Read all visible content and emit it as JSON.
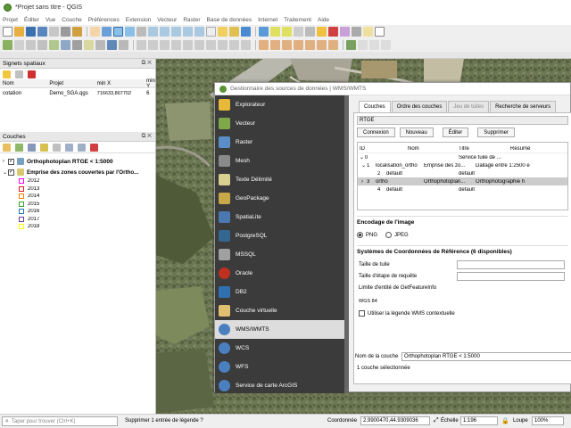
{
  "window": {
    "title": "*Projet sans titre - QGIS"
  },
  "menu": [
    "Projet",
    "Éditer",
    "Vue",
    "Couche",
    "Préférences",
    "Extension",
    "Vecteur",
    "Raster",
    "Base de données",
    "Internet",
    "Traitement",
    "Aide"
  ],
  "bookmarks": {
    "title": "Signets spatiaux",
    "columns": [
      "Nom",
      "Projet",
      "min X",
      "min Y"
    ],
    "row": [
      "cotation",
      "Demo_SGA.qgs",
      "716633,867702",
      "6"
    ]
  },
  "layers": {
    "title": "Couches",
    "items": [
      {
        "label": "Orthophotoplan RTGE < 1:5000",
        "checked": true,
        "bold": true
      },
      {
        "label": "Emprise des zones couvertes par l'Ortho...",
        "checked": true,
        "bold": true
      }
    ],
    "years": [
      {
        "label": "2012",
        "color": "#ff00ff"
      },
      {
        "label": "2013",
        "color": "#e31a1c"
      },
      {
        "label": "2014",
        "color": "#ff7f00"
      },
      {
        "label": "2015",
        "color": "#33a02c"
      },
      {
        "label": "2016",
        "color": "#1f78b4"
      },
      {
        "label": "2017",
        "color": "#6a3d9a"
      },
      {
        "label": "2018",
        "color": "#ffff00"
      }
    ]
  },
  "dialog": {
    "title": "Gestionnaire des sources de données | WMS/WMTS",
    "side": [
      "Explorateur",
      "Vecteur",
      "Raster",
      "Mesh",
      "Texte Délimité",
      "GeoPackage",
      "SpatiaLite",
      "PostgreSQL",
      "MSSQL",
      "Oracle",
      "DB2",
      "Couche virtuelle",
      "WMS/WMTS",
      "WCS",
      "WFS",
      "Service de carte ArcGIS"
    ],
    "tabs": [
      "Couches",
      "Ordre des couches",
      "Jeu de tuiles",
      "Recherche de serveurs"
    ],
    "connection": "RTGE",
    "buttons": [
      "Connexion",
      "Nouveau",
      "Éditer",
      "Supprimer"
    ],
    "tree_headers": [
      "ID",
      "Nom",
      "Titre",
      "Résumé"
    ],
    "tree_rows": [
      {
        "id": "0",
        "name": "",
        "title": "Service tuilé de ...",
        "resume": ""
      },
      {
        "id": "1",
        "name": "localisation_ortho",
        "title": "Emprise des zo...",
        "resume": "Dallage entre 1:2500 e"
      },
      {
        "id": "2",
        "name": "default",
        "title": "default",
        "resume": ""
      },
      {
        "id": "3",
        "name": "ortho",
        "title": "Orthophotoplan...",
        "resume": "Orthophotographie h"
      },
      {
        "id": "4",
        "name": "default",
        "title": "default",
        "resume": ""
      }
    ],
    "encoding_title": "Encodage de l'image",
    "png": "PNG",
    "jpeg": "JPEG",
    "crs_title": "Systèmes de Coordonnées de Référence (6 disponibles)",
    "tile_size": "Taille de tuile",
    "step_size": "Taille d'étape de requête",
    "feature_limit": "Limite d'entité de GetFeatureInfo",
    "crs": "WGS 84",
    "legend": "Utiliser la légende WMS contextuelle",
    "layer_name_label": "Nom de la couche",
    "layer_name": "Orthophotoplan RTGE < 1:5000",
    "selected": "1 couche sélectionnée"
  },
  "status": {
    "search_placeholder": "Taper pour trouver (Ctrl+K)",
    "message": "Supprimer 1 entrée de légende ?",
    "coord_label": "Coordonnée",
    "coord": "2.9900470,44.9309036",
    "scale_label": "Échelle",
    "scale": "1:196",
    "loupe_label": "Loupe",
    "loupe": "100%"
  }
}
